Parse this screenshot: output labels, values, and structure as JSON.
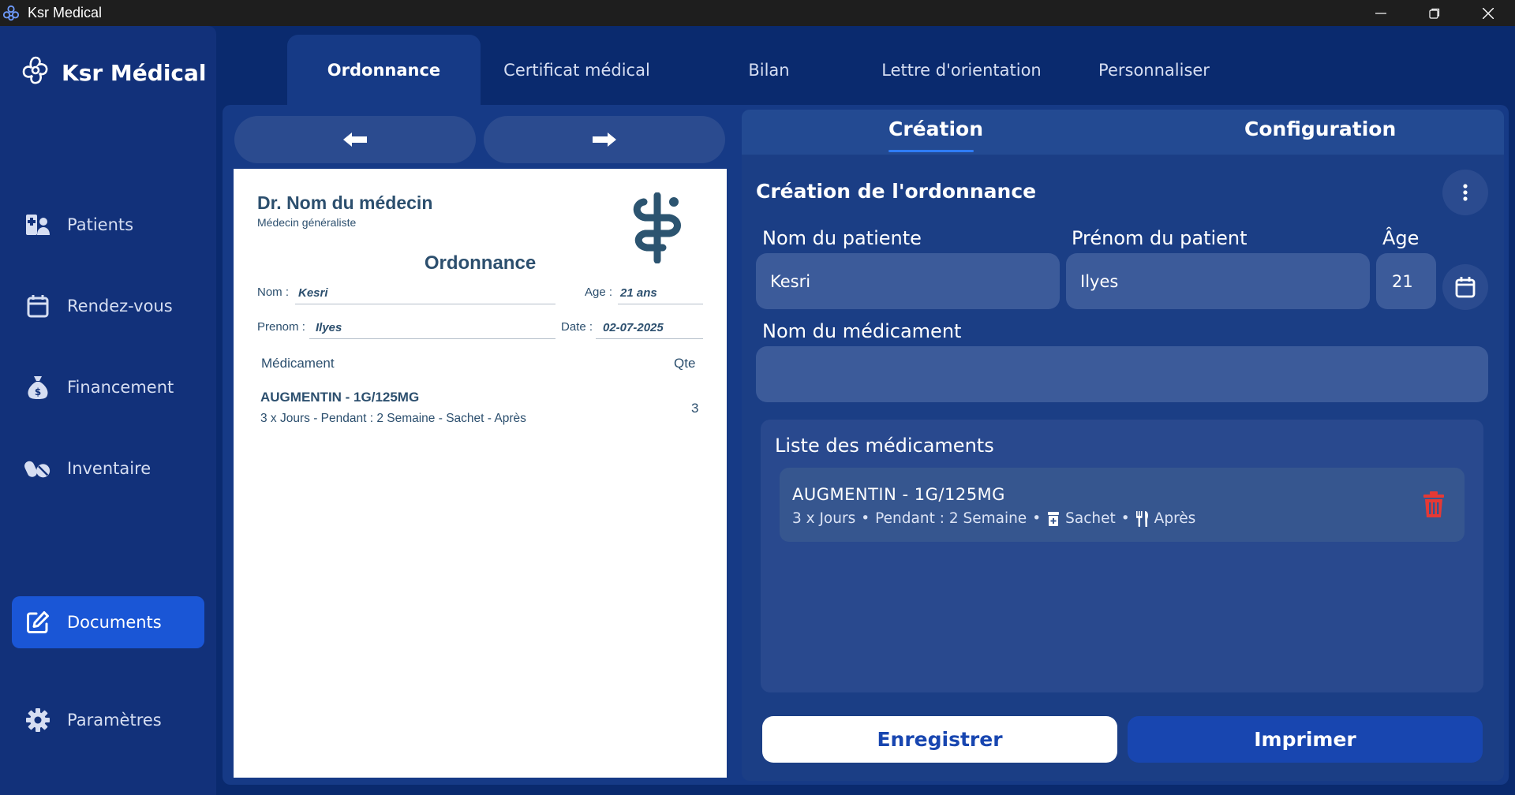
{
  "window": {
    "title": "Ksr Medical"
  },
  "sidebar": {
    "brand": "Ksr Médical",
    "items": [
      {
        "label": "Patients",
        "icon": "patient-icon"
      },
      {
        "label": "Rendez-vous",
        "icon": "calendar-icon"
      },
      {
        "label": "Financement",
        "icon": "money-bag-icon"
      },
      {
        "label": "Inventaire",
        "icon": "pills-icon"
      },
      {
        "label": "Documents",
        "icon": "edit-document-icon",
        "active": true
      },
      {
        "label": "Paramètres",
        "icon": "gear-icon"
      }
    ]
  },
  "tabs": [
    {
      "label": "Ordonnance",
      "active": true
    },
    {
      "label": "Certificat médical"
    },
    {
      "label": "Bilan"
    },
    {
      "label": "Lettre d'orientation"
    },
    {
      "label": "Personnaliser"
    }
  ],
  "preview": {
    "doctor_name": "Dr. Nom du médecin",
    "specialty": "Médecin généraliste",
    "doc_title": "Ordonnance",
    "nom_label": "Nom :",
    "nom_value": "Kesri",
    "age_label": "Age :",
    "age_value": "21 ans",
    "prenom_label": "Prenom :",
    "prenom_value": "Ilyes",
    "date_label": "Date :",
    "date_value": "02-07-2025",
    "col_med": "Médicament",
    "col_qty": "Qte",
    "med_name": "AUGMENTIN - 1G/125MG",
    "med_detail": "3 x Jours - Pendant : 2 Semaine - Sachet - Après",
    "med_qty": "3"
  },
  "form": {
    "subtabs": {
      "creation": "Création",
      "configuration": "Configuration"
    },
    "title": "Création de l'ordonnance",
    "nom_label": "Nom du patiente",
    "nom_value": "Kesri",
    "prenom_label": "Prénom du patient",
    "prenom_value": "Ilyes",
    "age_label": "Âge",
    "age_value": "21",
    "med_label": "Nom du médicament",
    "med_value": "",
    "list_title": "Liste des médicaments",
    "list": [
      {
        "name": "AUGMENTIN - 1G/125MG",
        "frequency": "3 x Jours",
        "duration": "Pendant : 2 Semaine",
        "form": "Sachet",
        "timing": "Après"
      }
    ],
    "save_label": "Enregistrer",
    "print_label": "Imprimer"
  },
  "colors": {
    "background": "#0a2a6e",
    "sidebar": "#12317a",
    "active": "#1a56d6",
    "danger": "#e53935",
    "accent_underline": "#2f7cf6"
  }
}
